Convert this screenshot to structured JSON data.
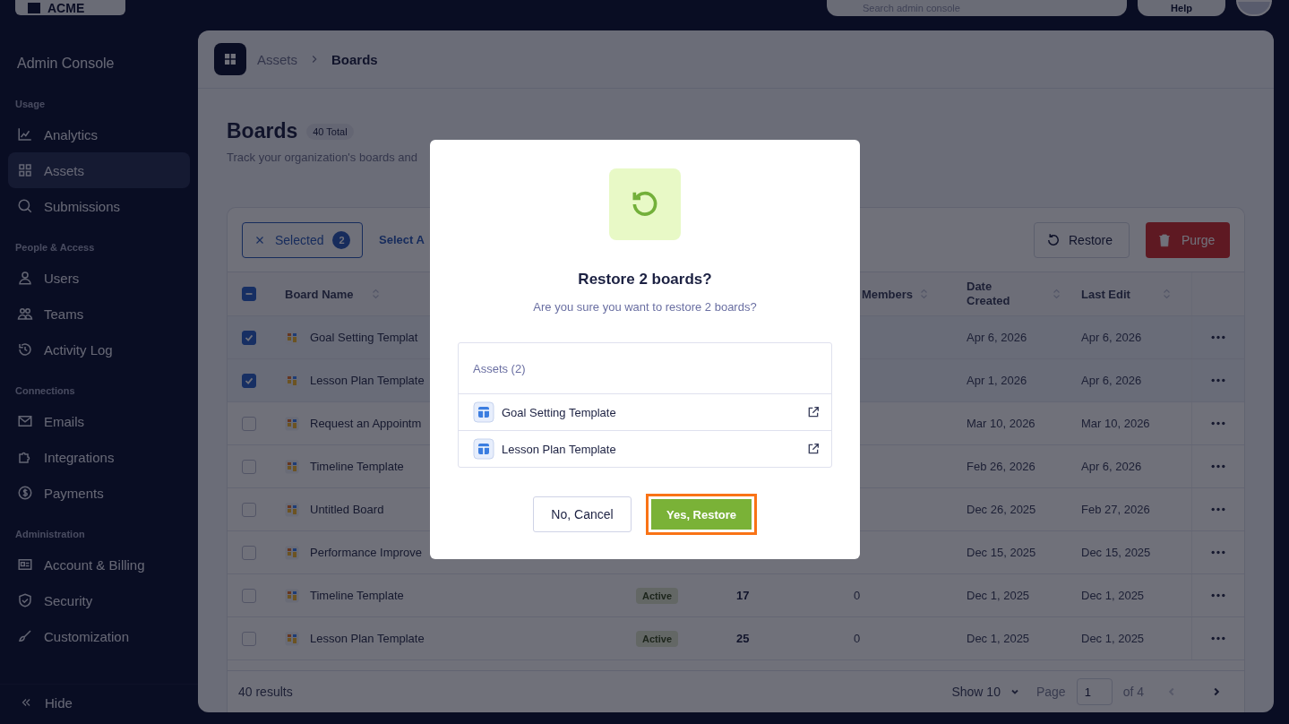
{
  "top_bar": {
    "logo": "ACME",
    "search": {
      "placeholder": "Search admin console"
    },
    "help": "Help"
  },
  "sidebar": {
    "title": "Admin Console",
    "groups": [
      {
        "heading": "Usage",
        "items": [
          {
            "label": "Analytics",
            "selected": false
          },
          {
            "label": "Assets",
            "selected": true
          },
          {
            "label": "Submissions",
            "selected": false
          }
        ]
      },
      {
        "heading": "People & Access",
        "items": [
          {
            "label": "Users",
            "selected": false
          },
          {
            "label": "Teams",
            "selected": false
          },
          {
            "label": "Activity Log",
            "selected": false
          }
        ]
      },
      {
        "heading": "Connections",
        "items": [
          {
            "label": "Emails",
            "selected": false
          },
          {
            "label": "Integrations",
            "selected": false
          },
          {
            "label": "Payments",
            "selected": false
          }
        ]
      },
      {
        "heading": "Administration",
        "items": [
          {
            "label": "Account & Billing",
            "selected": false
          },
          {
            "label": "Security",
            "selected": false
          },
          {
            "label": "Customization",
            "selected": false
          }
        ]
      }
    ],
    "hide": "Hide"
  },
  "breadcrumb": [
    "Assets",
    "Boards"
  ],
  "page": {
    "title": "Boards",
    "total_badge": "40 Total",
    "subtitle": "Track your organization's boards and"
  },
  "toolbar": {
    "selected_label": "Selected",
    "selected_count": "2",
    "select_all": "Select A",
    "restore": "Restore",
    "purge": "Purge"
  },
  "table": {
    "some_selected": true,
    "columns": [
      "Board Name",
      "Members",
      "Date Created",
      "Last Edit"
    ],
    "rows": [
      {
        "name": "Goal Setting Templat",
        "selected": true,
        "date_created": "Apr 6, 2026",
        "last_edit": "Apr 6, 2026"
      },
      {
        "name": "Lesson Plan Template",
        "selected": true,
        "date_created": "Apr 1, 2026",
        "last_edit": "Apr 6, 2026"
      },
      {
        "name": "Request an Appointm",
        "selected": false,
        "date_created": "Mar 10, 2026",
        "last_edit": "Mar 10, 2026"
      },
      {
        "name": "Timeline Template",
        "selected": false,
        "date_created": "Feb 26, 2026",
        "last_edit": "Apr 6, 2026"
      },
      {
        "name": "Untitled Board",
        "selected": false,
        "date_created": "Dec 26, 2025",
        "last_edit": "Feb 27, 2026"
      },
      {
        "name": "Performance Improve",
        "selected": false,
        "date_created": "Dec 15, 2025",
        "last_edit": "Dec 15, 2025"
      },
      {
        "name": "Timeline Template",
        "selected": false,
        "status": "Active",
        "col_4": "17",
        "members": "0",
        "date_created": "Dec 1, 2025",
        "last_edit": "Dec 1, 2025"
      },
      {
        "name": "Lesson Plan Template",
        "selected": false,
        "status": "Active",
        "col_4": "25",
        "members": "0",
        "date_created": "Dec 1, 2025",
        "last_edit": "Dec 1, 2025"
      }
    ]
  },
  "footer": {
    "results": "40 results",
    "show": "Show 10",
    "page_label": "Page",
    "page_value": "1",
    "of": "of 4",
    "prev_disabled": true
  },
  "dialog": {
    "title": "Restore 2 boards?",
    "message": "Are you sure you want to restore 2 boards?",
    "assets_heading": "Assets (2)",
    "assets": [
      "Goal Setting Template",
      "Lesson Plan Template"
    ],
    "cancel": "No, Cancel",
    "confirm": {
      "label": "Yes, Restore",
      "focused": true
    }
  }
}
